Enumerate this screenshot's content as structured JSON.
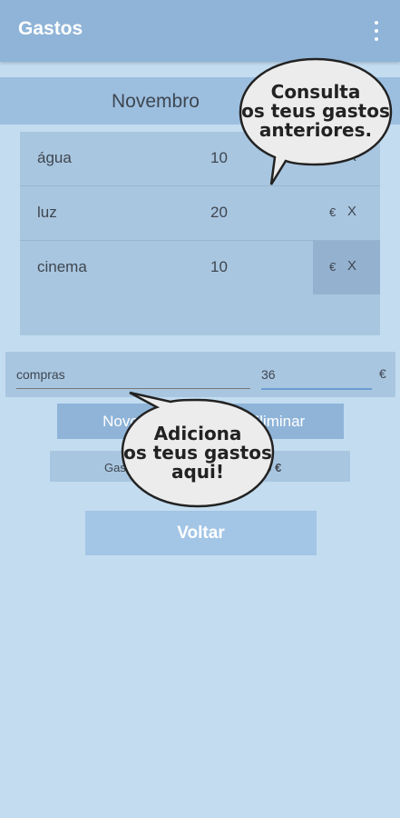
{
  "appbar": {
    "title": "Gastos",
    "menu_icon": "more-vert-icon"
  },
  "month": "Novembro",
  "expenses": [
    {
      "name": "água",
      "value": "10",
      "currency": "€",
      "delete": "X"
    },
    {
      "name": "luz",
      "value": "20",
      "currency": "€",
      "delete": "X"
    },
    {
      "name": "cinema",
      "value": "10",
      "currency": "€",
      "delete": "X"
    }
  ],
  "form": {
    "name_value": "compras",
    "amount_value": "36",
    "currency": "€"
  },
  "buttons": {
    "new": "Novo",
    "remove": "Eliminar",
    "back": "Voltar"
  },
  "total": {
    "label": "Gastos",
    "value": "40 €"
  },
  "bubbles": {
    "top": [
      "Consulta",
      "os teus gastos",
      "anteriores."
    ],
    "bottom": [
      "Adiciona",
      "os teus gastos",
      "aqui!"
    ]
  },
  "colors": {
    "appbar": "#8fb4d8",
    "background": "#c3dcf0",
    "panel": "#a9c6e0"
  }
}
